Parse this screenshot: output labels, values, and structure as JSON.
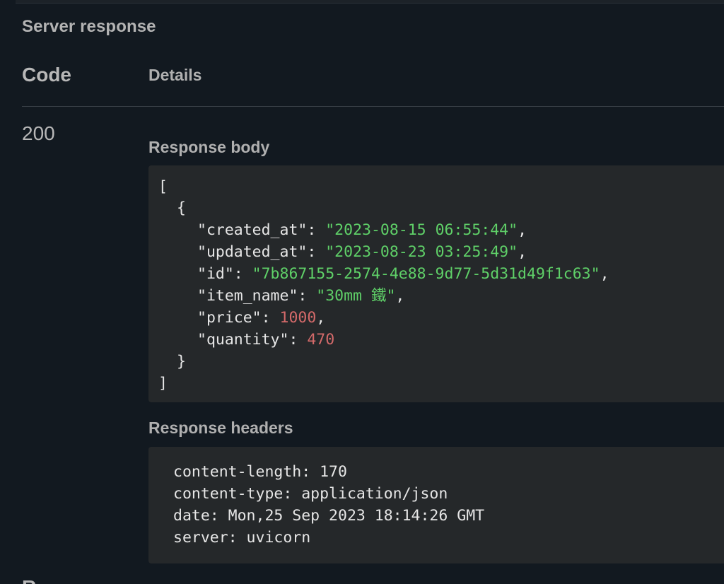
{
  "section": {
    "title": "Server response"
  },
  "table": {
    "code_header": "Code",
    "details_header": "Details",
    "status_code": "200"
  },
  "response_body": {
    "title": "Response body",
    "open_bracket": "[",
    "open_brace": "{",
    "fields": [
      {
        "key": "\"created_at\"",
        "sep": ": ",
        "value": "\"2023-08-15 06:55:44\"",
        "type": "string",
        "comma": ","
      },
      {
        "key": "\"updated_at\"",
        "sep": ": ",
        "value": "\"2023-08-23 03:25:49\"",
        "type": "string",
        "comma": ","
      },
      {
        "key": "\"id\"",
        "sep": ": ",
        "value": "\"7b867155-2574-4e88-9d77-5d31d49f1c63\"",
        "type": "string",
        "comma": ","
      },
      {
        "key": "\"item_name\"",
        "sep": ": ",
        "value": "\"30mm 鐵\"",
        "type": "string",
        "comma": ","
      },
      {
        "key": "\"price\"",
        "sep": ": ",
        "value": "1000",
        "type": "number",
        "comma": ","
      },
      {
        "key": "\"quantity\"",
        "sep": ": ",
        "value": "470",
        "type": "number",
        "comma": ""
      }
    ],
    "close_brace": "}",
    "close_bracket": "]"
  },
  "response_headers": {
    "title": "Response headers",
    "lines": [
      "content-length: 170",
      "content-type: application/json",
      "date: Mon,25 Sep 2023 18:14:26 GMT",
      "server: uvicorn"
    ]
  },
  "colors": {
    "background": "#121920",
    "code_background": "#25282a",
    "string": "#5fd068",
    "number": "#d46a6a",
    "heading": "#b0b0b0"
  },
  "bottom_peek": "R"
}
